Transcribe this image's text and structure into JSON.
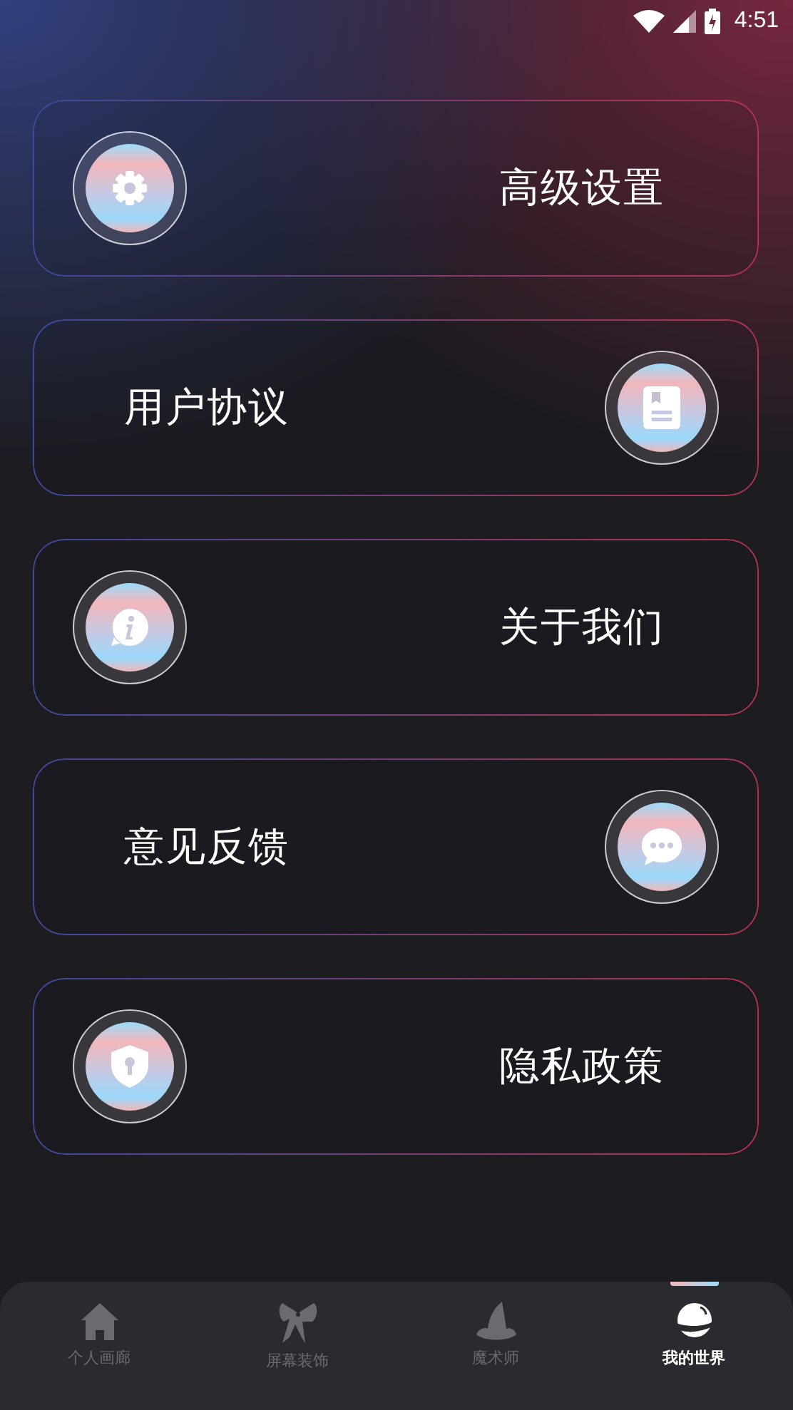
{
  "status_bar": {
    "time": "4:51"
  },
  "menu": [
    {
      "label": "高级设置"
    },
    {
      "label": "用户协议"
    },
    {
      "label": "关于我们"
    },
    {
      "label": "意见反馈"
    },
    {
      "label": "隐私政策"
    }
  ],
  "tabs": [
    {
      "label": "个人画廊",
      "selected": false
    },
    {
      "label": "屏幕装饰",
      "selected": false
    },
    {
      "label": "魔术师",
      "selected": false
    },
    {
      "label": "我的世界",
      "selected": true
    }
  ]
}
